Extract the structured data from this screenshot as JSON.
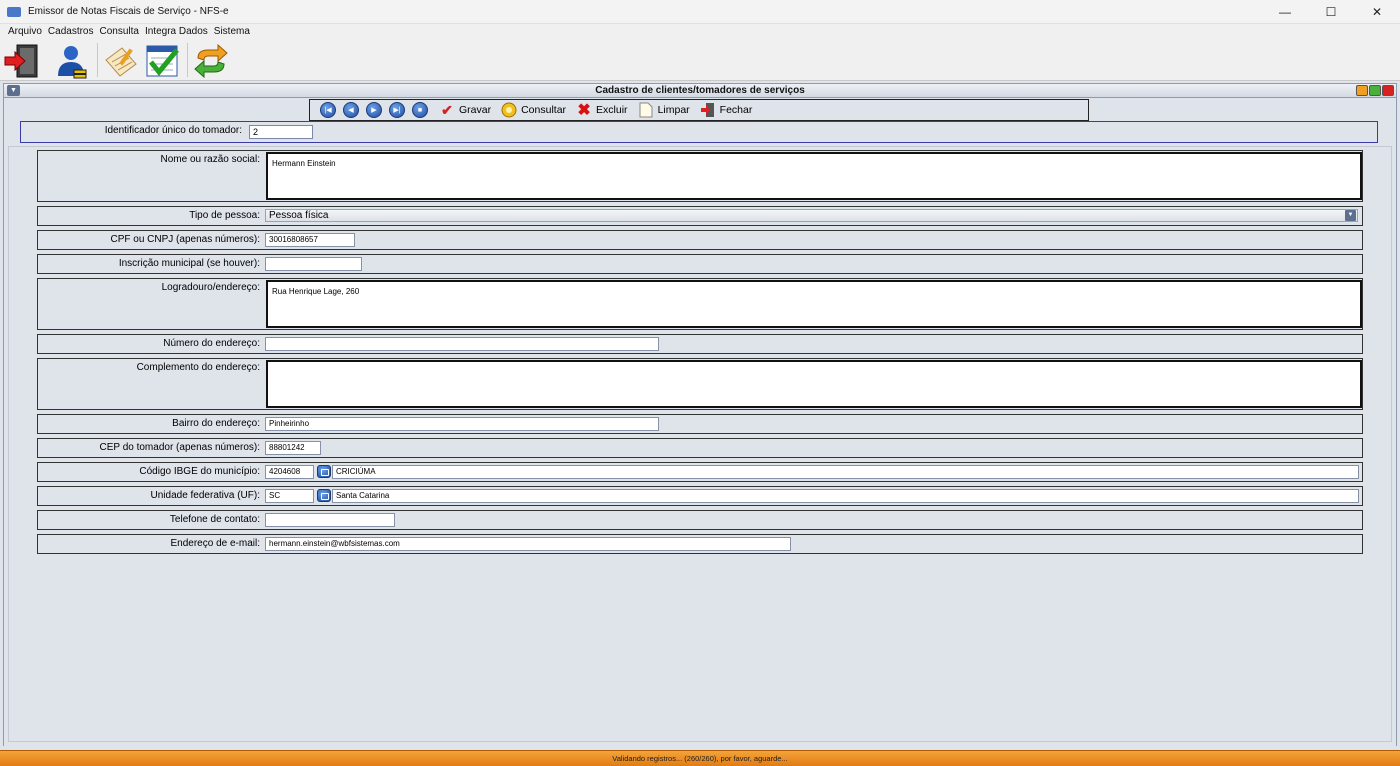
{
  "window": {
    "title": "Emissor de Notas Fiscais de Serviço - NFS-e",
    "minimize": "—",
    "maximize": "☐",
    "close": "✕"
  },
  "menu": [
    "Arquivo",
    "Cadastros",
    "Consulta",
    "Integra Dados",
    "Sistema"
  ],
  "toolbar_icons": [
    "exit-icon",
    "user-icon",
    "notes-icon",
    "checklist-icon",
    "sync-icon"
  ],
  "frame": {
    "title": "Cadastro de clientes/tomadores de serviços"
  },
  "record_toolbar": {
    "nav_first": "first-record-icon",
    "nav_prev": "previous-record-icon",
    "nav_next": "next-record-icon",
    "nav_last": "last-record-icon",
    "nav_stop": "stop-icon",
    "gravar": "Gravar",
    "consultar": "Consultar",
    "excluir": "Excluir",
    "limpar": "Limpar",
    "fechar": "Fechar"
  },
  "id_field": {
    "label": "Identificador único do tomador:",
    "value": "2"
  },
  "form": {
    "nome": {
      "label": "Nome ou razão social:",
      "value": "Hermann Einstein"
    },
    "tipo_pessoa": {
      "label": "Tipo de pessoa:",
      "value": "Pessoa física"
    },
    "cpf_cnpj": {
      "label": "CPF ou CNPJ (apenas números):",
      "value": "30016808657"
    },
    "inscricao": {
      "label": "Inscrição municipal (se houver):",
      "value": ""
    },
    "logradouro": {
      "label": "Logradouro/endereço:",
      "value": "Rua Henrique Lage, 260"
    },
    "numero": {
      "label": "Número do endereço:",
      "value": ""
    },
    "complemento": {
      "label": "Complemento do endereço:",
      "value": ""
    },
    "bairro": {
      "label": "Bairro do endereço:",
      "value": "Pinheirinho"
    },
    "cep": {
      "label": "CEP do tomador (apenas números):",
      "value": "88801242"
    },
    "ibge": {
      "label": "Código IBGE do município:",
      "value": "4204608",
      "name": "CRICIÚMA"
    },
    "uf": {
      "label": "Unidade federativa (UF):",
      "value": "SC",
      "name": "Santa Catarina"
    },
    "telefone": {
      "label": "Telefone de contato:",
      "value": ""
    },
    "email": {
      "label": "Endereço de e-mail:",
      "value": "hermann.einstein@wbfsistemas.com"
    }
  },
  "status": "Validando registros... (260/260), por favor, aguarde..."
}
